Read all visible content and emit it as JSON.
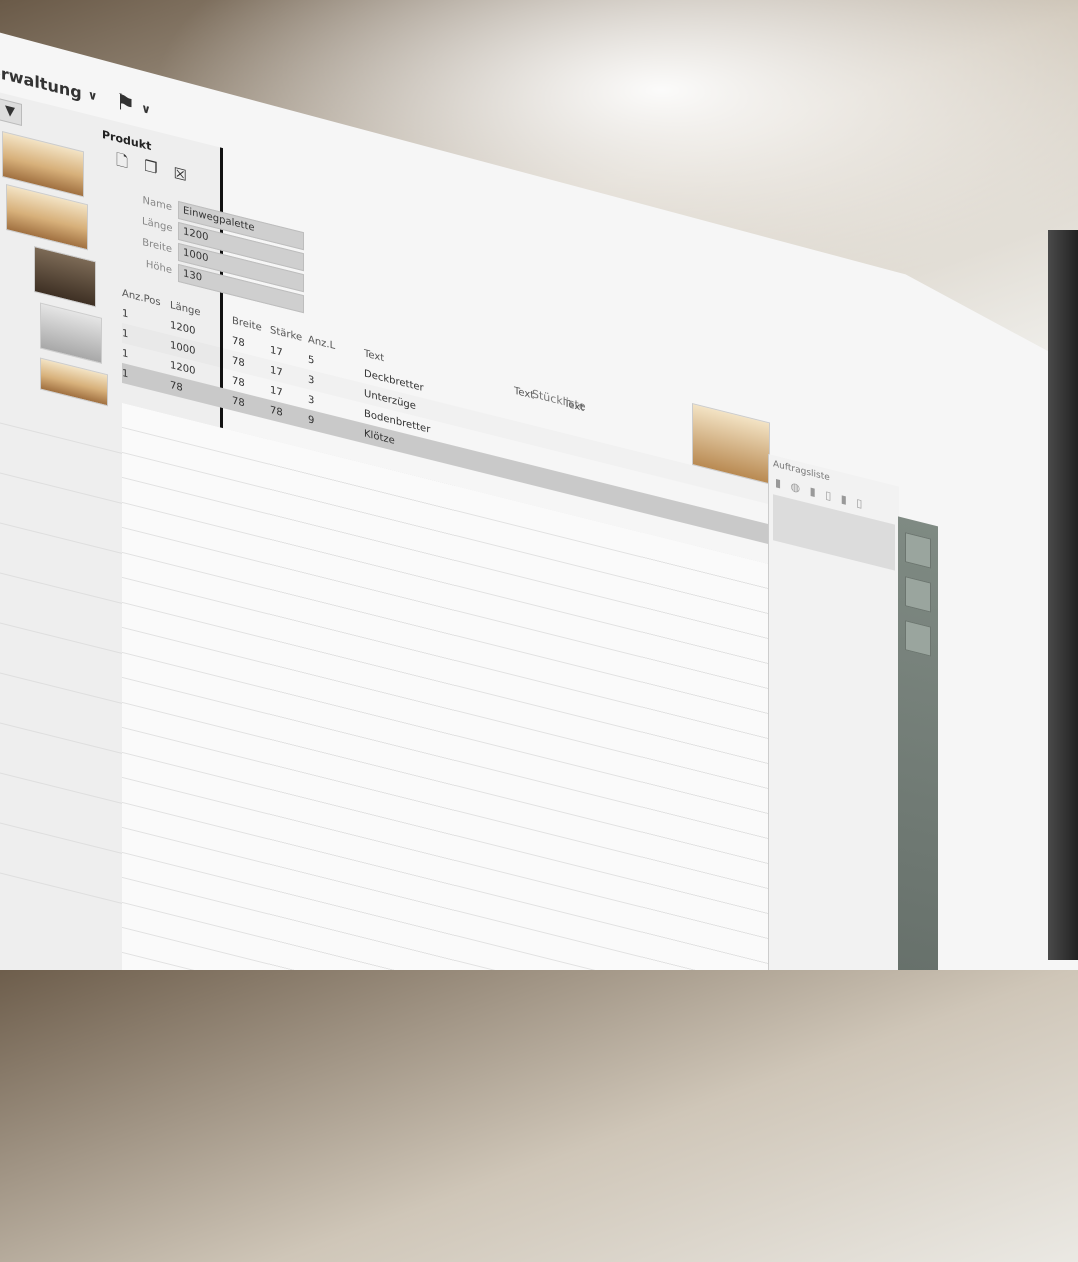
{
  "app": {
    "menu_label": "erwaltung",
    "flag_menu": "flag"
  },
  "left_panel": {
    "filter_icon": "filter-icon",
    "thumbnails": 5
  },
  "product": {
    "section_title": "Produkt",
    "toolbar": [
      "new-file-icon",
      "copy-icon",
      "delete-icon"
    ],
    "form": {
      "name_label": "Name",
      "name_value": "Einwegpalette",
      "laenge_label": "Länge",
      "laenge_value": "1200",
      "breite_label": "Breite",
      "breite_value": "1000",
      "hoehe_label": "Höhe",
      "hoehe_value": "130"
    },
    "table": {
      "headers": [
        "Anz.Pos",
        "Länge",
        "Breite",
        "Stärke",
        "Anz.L",
        "Text",
        "Text",
        "Text"
      ],
      "stueckliste_label": "Stückliste",
      "rows": [
        [
          "1",
          "1200",
          "78",
          "17",
          "5",
          "Deckbretter"
        ],
        [
          "1",
          "1000",
          "78",
          "17",
          "3",
          "Unterzüge"
        ],
        [
          "1",
          "1200",
          "78",
          "17",
          "3",
          "Bodenbretter"
        ],
        [
          "1",
          "78",
          "78",
          "78",
          "9",
          "Klötze"
        ]
      ]
    }
  },
  "right_panel": {
    "title": "Auftragsliste",
    "tools": "▮ ◍ ▮ ▯ ▮ ▯"
  }
}
